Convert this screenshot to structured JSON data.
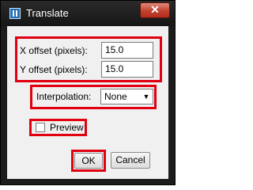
{
  "window": {
    "title": "Translate",
    "close_glyph": "✕",
    "icon": "imagej-app-icon"
  },
  "fields": {
    "x_offset_label": "X offset (pixels):",
    "x_offset_value": "15.0",
    "y_offset_label": "Y offset (pixels):",
    "y_offset_value": "15.0"
  },
  "interpolation": {
    "label": "Interpolation:",
    "selected": "None",
    "arrow_glyph": "▼"
  },
  "preview": {
    "label": "Preview",
    "checked": false
  },
  "buttons": {
    "ok_label": "OK",
    "cancel_label": "Cancel"
  },
  "colors": {
    "highlight_box": "#e0000f",
    "dialog_background": "#f0f0f0",
    "title_bar": "#1c1c1c",
    "close_button": "#c2412e"
  }
}
